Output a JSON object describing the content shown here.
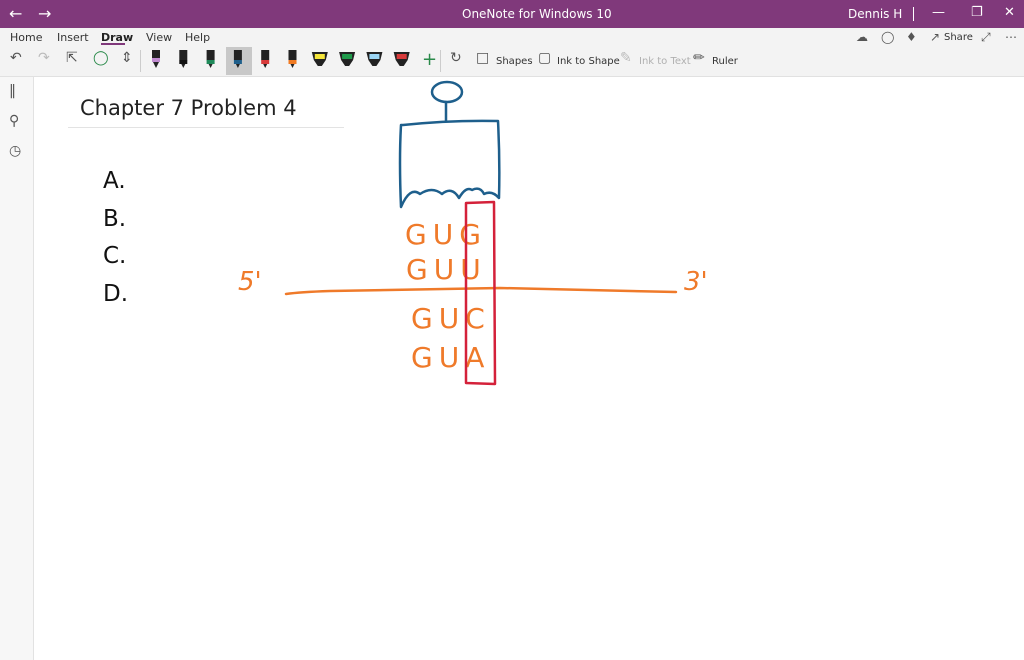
{
  "window": {
    "title": "OneNote for Windows 10",
    "user": "Dennis H",
    "back_icon": "back-arrow-icon",
    "forward_icon": "forward-arrow-icon"
  },
  "menu": {
    "tabs": [
      {
        "label": "Home"
      },
      {
        "label": "Insert"
      },
      {
        "label": "Draw",
        "active": true
      },
      {
        "label": "View"
      },
      {
        "label": "Help"
      }
    ],
    "share_label": "Share"
  },
  "toolbar": {
    "shapes_label": "Shapes",
    "ink_to_shape_label": "Ink to Shape",
    "ink_to_text_label": "Ink to Text",
    "ruler_label": "Ruler",
    "pens": [
      {
        "color": "#c08bd0",
        "kind": "pen"
      },
      {
        "color": "#111111",
        "kind": "pen"
      },
      {
        "color": "#1f8a5a",
        "kind": "pen"
      },
      {
        "color": "#1f5f8b",
        "kind": "pen",
        "selected": true
      },
      {
        "color": "#d83b3b",
        "kind": "pen"
      },
      {
        "color": "#f07a22",
        "kind": "pen"
      },
      {
        "color": "#f5e63a",
        "kind": "highlighter"
      },
      {
        "color": "#1f9a4a",
        "kind": "highlighter"
      },
      {
        "color": "#9cd6f5",
        "kind": "highlighter"
      },
      {
        "color": "#d83b3b",
        "kind": "highlighter"
      }
    ]
  },
  "page": {
    "title": "Chapter 7 Problem 4",
    "options": [
      "A.",
      "B.",
      "C.",
      "D."
    ]
  },
  "ink": {
    "labels": [
      "5'",
      "3'"
    ],
    "codons": [
      "GUG",
      "GUU",
      "GUC",
      "GUA"
    ],
    "colors": {
      "orange": "#ef7a2a",
      "blue": "#1e5f8c",
      "red": "#d4213a"
    }
  }
}
